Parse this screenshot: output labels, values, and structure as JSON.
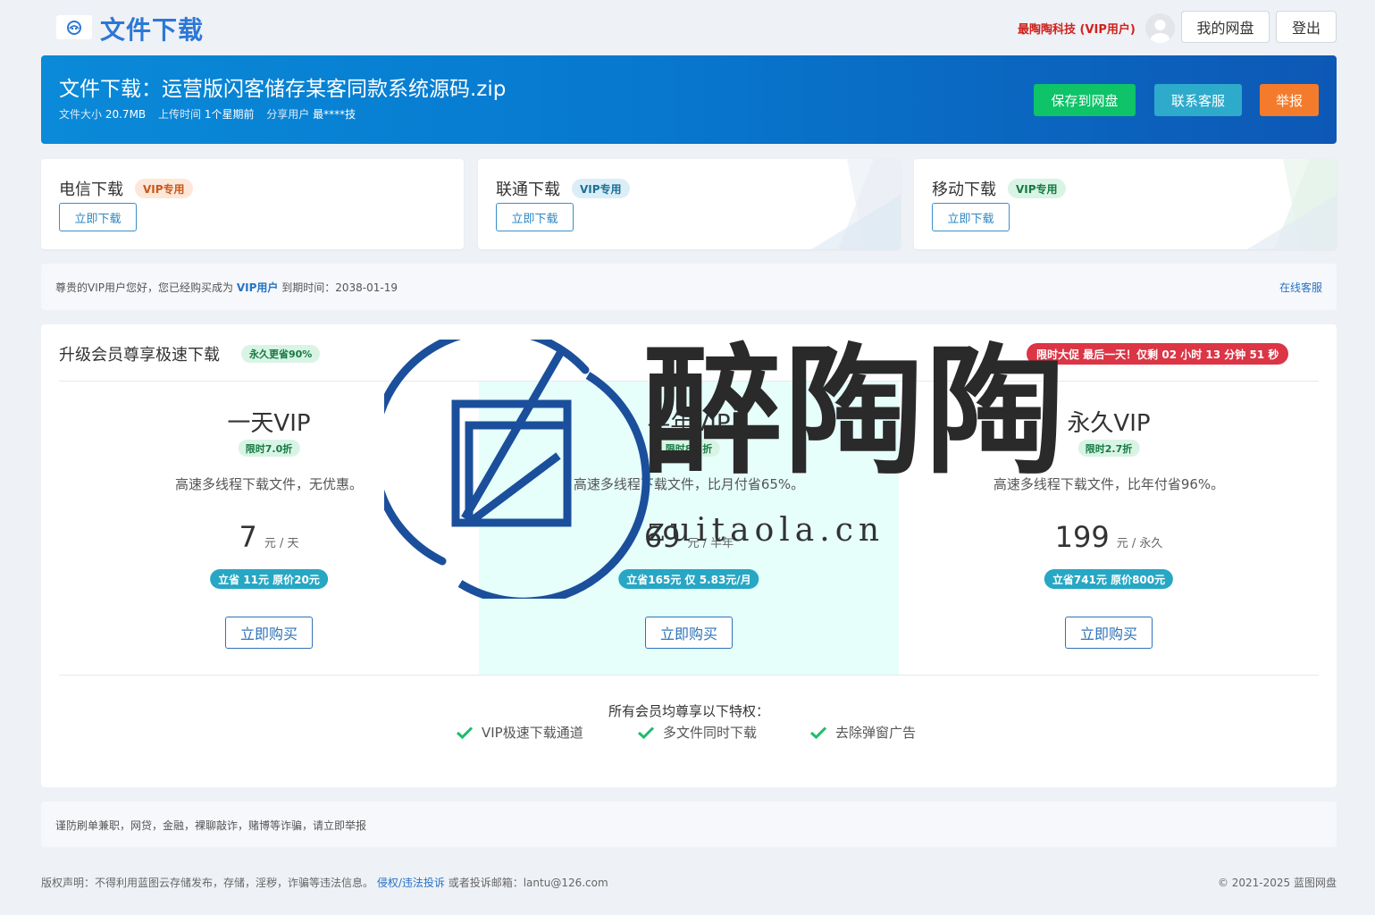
{
  "header": {
    "logo_text": "文件下载",
    "user_name": "最陶陶科技 (VIP用户)",
    "my_disk_label": "我的网盘",
    "logout_label": "登出"
  },
  "banner": {
    "title": "文件下载：运营版闪客储存某客同款系统源码.zip",
    "size_label": "文件大小",
    "size_value": "20.7MB",
    "upload_label": "上传时间",
    "upload_value": "1个星期前",
    "share_label": "分享用户",
    "share_value": "最****技",
    "save_btn": "保存到网盘",
    "contact_btn": "联系客服",
    "report_btn": "举报",
    "colors": {
      "save": "#0ec368",
      "contact": "#2eaacb",
      "report": "#f57b2c"
    }
  },
  "downloads": [
    {
      "title": "电信下载",
      "tag": "VIP专用",
      "button": "立即下载",
      "tag_bg": "#fde7d9",
      "tag_fg": "#c7581c"
    },
    {
      "title": "联通下载",
      "tag": "VIP专用",
      "button": "立即下载",
      "tag_bg": "#dbeef7",
      "tag_fg": "#1d6f98"
    },
    {
      "title": "移动下载",
      "tag": "VIP专用",
      "button": "立即下载",
      "tag_bg": "#d9f4e5",
      "tag_fg": "#167a43"
    }
  ],
  "notice": {
    "prefix": "尊贵的VIP用户您好，您已经购买成为",
    "highlight": "VIP用户",
    "suffix": "到期时间：2038-01-19",
    "link": "在线客服"
  },
  "plans_panel": {
    "title": "升级会员尊享极速下载",
    "save_tag": "永久更省90%",
    "promo": "限时大促 最后一天！仅剩 02 小时 13 分钟 51 秒",
    "plans": [
      {
        "name": "一天VIP",
        "discount": "限时7.0折",
        "desc": "高速多线程下载文件，无优惠。",
        "price": "7",
        "unit": "元 / 天",
        "badge": "立省 11元 原价20元",
        "buy": "立即购买"
      },
      {
        "name": "半年VIP",
        "discount": "限时8.2折",
        "desc": "高速多线程下载文件，比月付省65%。",
        "price": "69",
        "unit": "元 / 半年",
        "badge": "立省165元 仅 5.83元/月",
        "buy": "立即购买"
      },
      {
        "name": "永久VIP",
        "discount": "限时2.7折",
        "desc": "高速多线程下载文件，比年付省96%。",
        "price": "199",
        "unit": "元 / 永久",
        "badge": "立省741元 原价800元",
        "buy": "立即购买"
      }
    ],
    "perks_title": "所有会员均尊享以下特权：",
    "perks": [
      "VIP极速下载通道",
      "多文件同时下载",
      "去除弹窗广告"
    ]
  },
  "warning": "谨防刷单兼职，网贷，金融，裸聊敲诈，赌博等诈骗，请立即举报",
  "footer": {
    "left_prefix": "版权声明：不得利用蓝图云存储发布，存储，淫秽，诈骗等违法信息。",
    "left_link": "侵权/违法投诉",
    "left_suffix": "或者投诉邮箱：lantu@126.com",
    "right": "© 2021-2025 蓝图网盘"
  },
  "watermark": {
    "text": "醉陶陶",
    "url": "zuitaola.cn"
  }
}
